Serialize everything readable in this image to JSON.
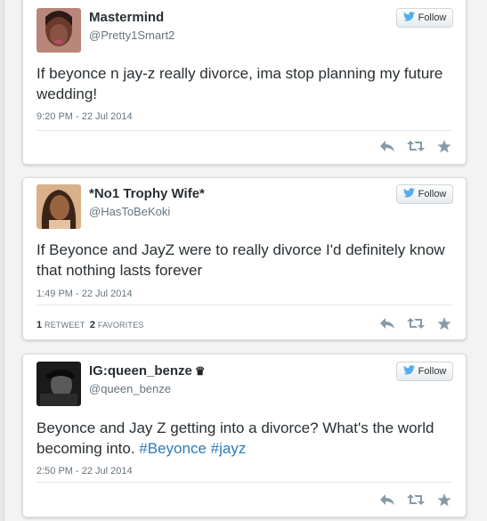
{
  "follow_label": "Follow",
  "tweets": [
    {
      "name": "Mastermind",
      "handle": "@Pretty1Smart2",
      "text": "If beyonce n jay-z really divorce, ima stop planning my future wedding!",
      "time": "9:20 PM - 22 Jul 2014",
      "actions": [
        "reply-icon",
        "retweet-icon",
        "favorite-icon"
      ]
    },
    {
      "name": "*No1 Trophy Wife*",
      "handle": "@HasToBeKoki",
      "text": "If Beyonce and JayZ were to really divorce I'd definitely know that nothing lasts forever",
      "time": "1:49 PM - 22 Jul 2014",
      "retweets": "1",
      "retweets_label": "RETWEET",
      "favorites": "2",
      "favorites_label": "FAVORITES",
      "actions": [
        "reply-icon",
        "retweet-icon",
        "favorite-icon"
      ]
    },
    {
      "name": "IG:queen_benze",
      "name_badge": "crown-icon",
      "handle": "@queen_benze",
      "text_plain": "Beyonce and Jay Z getting into a divorce? What's the world becoming into. ",
      "hashtag1": "#Beyonce",
      "hashtag2": "#jayz",
      "time": "2:50 PM - 22 Jul 2014",
      "actions": [
        "reply-icon",
        "retweet-icon",
        "favorite-icon"
      ]
    }
  ],
  "colors": {
    "name": "#292f33",
    "meta": "#66757f",
    "hashtag": "#2b7bb9",
    "twitter_bird": "#55acee",
    "action_icon": "#8899a6",
    "background": "#f3f3f3"
  }
}
